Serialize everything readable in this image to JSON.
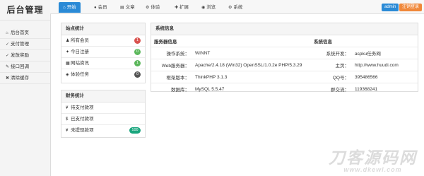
{
  "sidebar": {
    "logo": "后台管理",
    "items": [
      {
        "icon": "home-icon",
        "glyph": "⌂",
        "label": "后台首页"
      },
      {
        "icon": "cart-icon",
        "glyph": "✓",
        "label": "支付管理"
      },
      {
        "icon": "reward-icon",
        "glyph": "✓",
        "label": "发放奖励"
      },
      {
        "icon": "link-icon",
        "glyph": "✎",
        "label": "接口回调"
      },
      {
        "icon": "close-icon",
        "glyph": "✖",
        "label": "清除缓存"
      }
    ]
  },
  "topbar": {
    "tabs": [
      {
        "icon": "home-icon",
        "glyph": "⌂",
        "label": "开始"
      },
      {
        "icon": "user-icon",
        "glyph": "●",
        "label": "会员"
      },
      {
        "icon": "document-icon",
        "glyph": "▤",
        "label": "文章"
      },
      {
        "icon": "gear-icon",
        "glyph": "⚙",
        "label": "体验"
      },
      {
        "icon": "puzzle-icon",
        "glyph": "✚",
        "label": "扩展"
      },
      {
        "icon": "eye-icon",
        "glyph": "◉",
        "label": "浏览"
      },
      {
        "icon": "settings-icon",
        "glyph": "⚙",
        "label": "系统"
      }
    ],
    "admin_label": "admin",
    "logout_label": "注销登录"
  },
  "stats": {
    "title": "站点统计",
    "rows": [
      {
        "icon": "users-icon",
        "glyph": "♟",
        "label": "所有会员",
        "badge": "1",
        "color": "#d9534f"
      },
      {
        "icon": "sun-icon",
        "glyph": "✦",
        "label": "今日注册",
        "badge": "0",
        "color": "#5cb85c"
      },
      {
        "icon": "globe-icon",
        "glyph": "▦",
        "label": "网站资讯",
        "badge": "1",
        "color": "#5bb75b"
      },
      {
        "icon": "gamepad-icon",
        "glyph": "◈",
        "label": "体验任务",
        "badge": "0",
        "color": "#555555"
      }
    ]
  },
  "finance": {
    "title": "财务统计",
    "rows": [
      {
        "icon": "yen-icon",
        "glyph": "¥",
        "label": "待支付款项",
        "badge": null,
        "color": null
      },
      {
        "icon": "dollar-icon",
        "glyph": "$",
        "label": "已支付款项",
        "badge": null,
        "color": null
      },
      {
        "icon": "yen-icon",
        "glyph": "¥",
        "label": "未提现款项",
        "badge": "100",
        "color": "#1aa67e"
      }
    ]
  },
  "sysinfo": {
    "title": "系统信息",
    "header": [
      "服务器信息",
      "系统信息"
    ],
    "rows": [
      {
        "k1": "操作系统：",
        "v1": "WINNT",
        "k2": "系统开发：",
        "v2": "aspku任务网"
      },
      {
        "k1": "Web服务器：",
        "v1": "Apache/2.4.18 (Win32) OpenSSL/1.0.2e PHP/5.3.29",
        "k2": "主页：",
        "v2": "http://www.huudi.com"
      },
      {
        "k1": "框架版本：",
        "v1": "ThinkPHP 3.1.3",
        "k2": "QQ号：",
        "v2": "395486566"
      },
      {
        "k1": "数据库：",
        "v1": "MySQL 5.5.47",
        "k2": "群交流：",
        "v2": "119368241"
      }
    ]
  },
  "watermark": {
    "main": "刀客源码网",
    "url": "www.dkewl.com"
  }
}
